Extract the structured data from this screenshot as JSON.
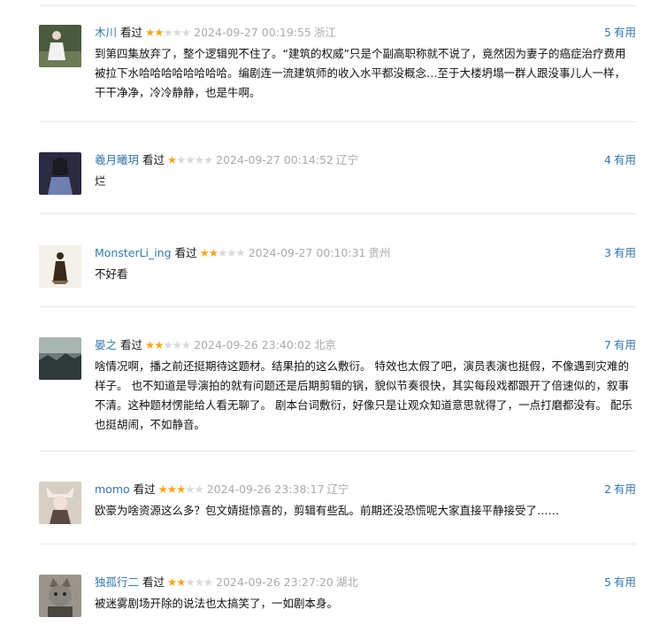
{
  "reviews": [
    {
      "user": "木川",
      "watched": "看过",
      "rating": 2,
      "time": "2024-09-27 00:19:55",
      "location": "浙江",
      "votes": "5",
      "votes_label": "有用",
      "content": "到第四集放弃了，整个逻辑兜不住了。“建筑的权威”只是个副高职称就不说了，竟然因为妻子的癌症治疗费用被拉下水哈哈哈哈哈哈哈哈。编剧连一流建筑师的收入水平都没概念…至于大楼坍塌一群人跟没事儿人一样，干干净净，冷冷静静，也是牛啊。",
      "avatar": {
        "bg": "#4a5a40",
        "fg": "#f2f2f2"
      }
    },
    {
      "user": "羲月曦玥",
      "watched": "看过",
      "rating": 1,
      "time": "2024-09-27 00:14:52",
      "location": "辽宁",
      "votes": "4",
      "votes_label": "有用",
      "content": "烂",
      "avatar": {
        "bg": "#2a2a40",
        "fg": "#6e7fb0"
      }
    },
    {
      "user": "MonsterLi_ing",
      "watched": "看过",
      "rating": 2,
      "time": "2024-09-27 00:10:31",
      "location": "贵州",
      "votes": "3",
      "votes_label": "有用",
      "content": "不好看",
      "avatar": {
        "bg": "#f4f1ea",
        "fg": "#3a2a1a"
      }
    },
    {
      "user": "晏之",
      "watched": "看过",
      "rating": 2,
      "time": "2024-09-26 23:40:02",
      "location": "北京",
      "votes": "7",
      "votes_label": "有用",
      "content": "啥情况啊，播之前还挺期待这题材。结果拍的这么敷衍。 特效也太假了吧，演员表演也挺假，不像遇到灾难的样子。 也不知道是导演拍的就有问题还是后期剪辑的锅，貌似节奏很快，其实每段戏都跟开了倍速似的，叙事不清。这种题材愣能给人看无聊了。 剧本台词敷衍，好像只是让观众知道意思就得了，一点打磨都没有。 配乐也挺胡闹，不如静音。",
      "avatar": {
        "bg": "#6b7a78",
        "fg": "#2e3a3a"
      }
    },
    {
      "user": "momo",
      "watched": "看过",
      "rating": 3,
      "time": "2024-09-26 23:38:17",
      "location": "辽宁",
      "votes": "2",
      "votes_label": "有用",
      "content": "欧豪为啥资源这么多？包文婧挺惊喜的，剪辑有些乱。前期还没恐慌呢大家直接平静接受了……",
      "avatar": {
        "bg": "#d8cfc4",
        "fg": "#5a4a40"
      }
    },
    {
      "user": "独孤行二",
      "watched": "看过",
      "rating": 2,
      "time": "2024-09-26 23:27:20",
      "location": "湖北",
      "votes": "5",
      "votes_label": "有用",
      "content": "被迷雾剧场开除的说法也太搞笑了，一如剧本身。",
      "avatar": {
        "bg": "#9a958c",
        "fg": "#4a4640"
      }
    }
  ]
}
